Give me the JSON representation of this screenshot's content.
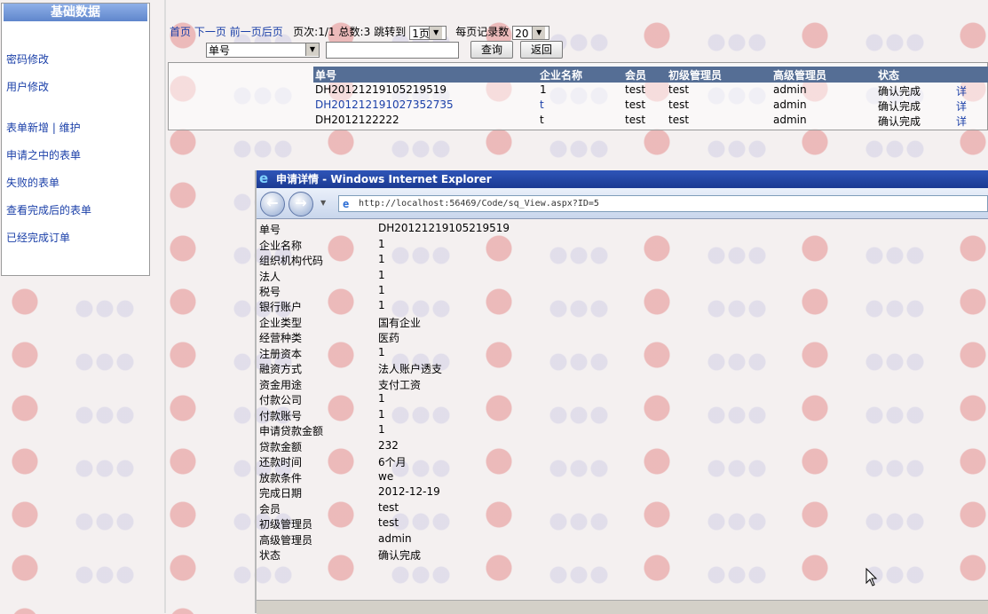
{
  "sidebar": {
    "title": "基础数据",
    "items": [
      {
        "label": "密码修改"
      },
      {
        "label": "用户修改"
      },
      {
        "label": "表单新增 | 维护"
      },
      {
        "label": "申请之中的表单"
      },
      {
        "label": "失败的表单"
      },
      {
        "label": "查看完成后的表单"
      },
      {
        "label": "已经完成订单"
      }
    ]
  },
  "pager": {
    "first": "首页",
    "next": "下一页",
    "prev": "前一页",
    "last": "后页",
    "page_info": "页次:1/1",
    "total": "总数:3",
    "jump_label": "跳转到",
    "jump_value": "1页",
    "per_page_label": "每页记录数",
    "per_page_value": "20"
  },
  "search": {
    "field_value": "单号",
    "query_button": "查询",
    "back_button": "返回"
  },
  "grid": {
    "columns": [
      "单号",
      "企业名称",
      "会员",
      "初级管理员",
      "高级管理员",
      "状态"
    ],
    "rows": [
      {
        "order_no": "DH20121219105219519",
        "company": "1",
        "member": "test",
        "junior": "test",
        "senior": "admin",
        "status": "确认完成",
        "detail": "详"
      },
      {
        "order_no": "DH201212191027352735",
        "company": "t",
        "member": "test",
        "junior": "test",
        "senior": "admin",
        "status": "确认完成",
        "detail": "详"
      },
      {
        "order_no": "DH2012122222",
        "company": "t",
        "member": "test",
        "junior": "test",
        "senior": "admin",
        "status": "确认完成",
        "detail": "详"
      }
    ]
  },
  "popup": {
    "window_title": "申请详情 - Windows Internet Explorer",
    "url": "http://localhost:56469/Code/sq_View.aspx?ID=5",
    "fields": [
      {
        "label": "单号",
        "value": "DH20121219105219519"
      },
      {
        "label": "企业名称",
        "value": "1"
      },
      {
        "label": "组织机构代码",
        "value": "1"
      },
      {
        "label": "法人",
        "value": "1"
      },
      {
        "label": "税号",
        "value": "1"
      },
      {
        "label": "银行账户",
        "value": "1"
      },
      {
        "label": "企业类型",
        "value": "国有企业"
      },
      {
        "label": "经营种类",
        "value": "医药"
      },
      {
        "label": "注册资本",
        "value": "1"
      },
      {
        "label": "融资方式",
        "value": "法人账户透支"
      },
      {
        "label": "资金用途",
        "value": "支付工资"
      },
      {
        "label": "付款公司",
        "value": "1"
      },
      {
        "label": "付款账号",
        "value": "1"
      },
      {
        "label": "申请贷款金额",
        "value": "1"
      },
      {
        "label": "贷款金额",
        "value": "232"
      },
      {
        "label": "还款时间",
        "value": "6个月"
      },
      {
        "label": "放款条件",
        "value": "we"
      },
      {
        "label": "完成日期",
        "value": "2012-12-19"
      },
      {
        "label": "会员",
        "value": "test"
      },
      {
        "label": "初级管理员",
        "value": "test"
      },
      {
        "label": "高级管理员",
        "value": "admin"
      },
      {
        "label": "状态",
        "value": "确认完成"
      }
    ]
  },
  "icons": {
    "ie_logo": "ie-logo-icon",
    "back": "back-arrow-icon",
    "forward": "forward-arrow-icon",
    "page": "page-icon",
    "cursor": "mouse-cursor-icon"
  }
}
